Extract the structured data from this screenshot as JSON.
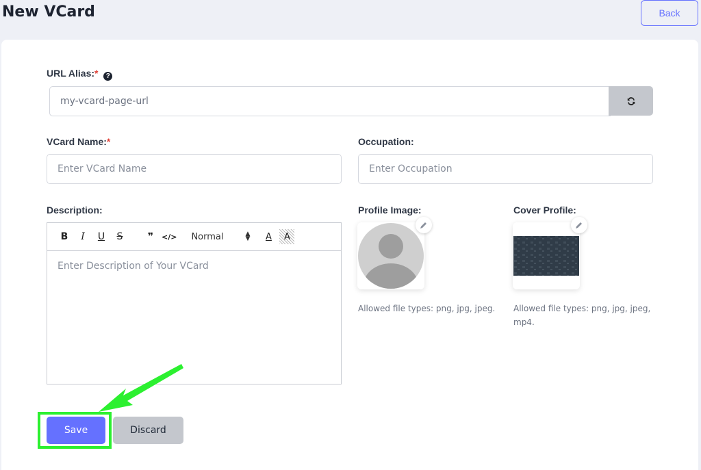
{
  "header": {
    "title": "New VCard",
    "back_label": "Back"
  },
  "form": {
    "url_alias": {
      "label": "URL Alias:",
      "required_mark": "*",
      "help_icon": "question-circle-icon",
      "value": "my-vcard-page-url",
      "refresh_icon": "refresh-icon"
    },
    "vcard_name": {
      "label": "VCard Name:",
      "required_mark": "*",
      "placeholder": "Enter VCard Name"
    },
    "occupation": {
      "label": "Occupation:",
      "placeholder": "Enter Occupation"
    },
    "description": {
      "label": "Description:",
      "placeholder": "Enter Description of Your VCard",
      "toolbar": {
        "bold": "B",
        "italic": "I",
        "underline": "U",
        "strike": "S",
        "quote": "❞",
        "code": "</>",
        "heading_select": "Normal",
        "text_color": "A",
        "background_color": "A"
      }
    },
    "profile_image": {
      "label": "Profile Image:",
      "hint": "Allowed file types: png, jpg, jpeg."
    },
    "cover_profile": {
      "label": "Cover Profile:",
      "hint": "Allowed file types: png, jpg, jpeg, mp4."
    }
  },
  "actions": {
    "save_label": "Save",
    "discard_label": "Discard"
  },
  "colors": {
    "primary": "#6571ff",
    "annotation": "#2cf030",
    "secondary": "#c4c7cd"
  }
}
